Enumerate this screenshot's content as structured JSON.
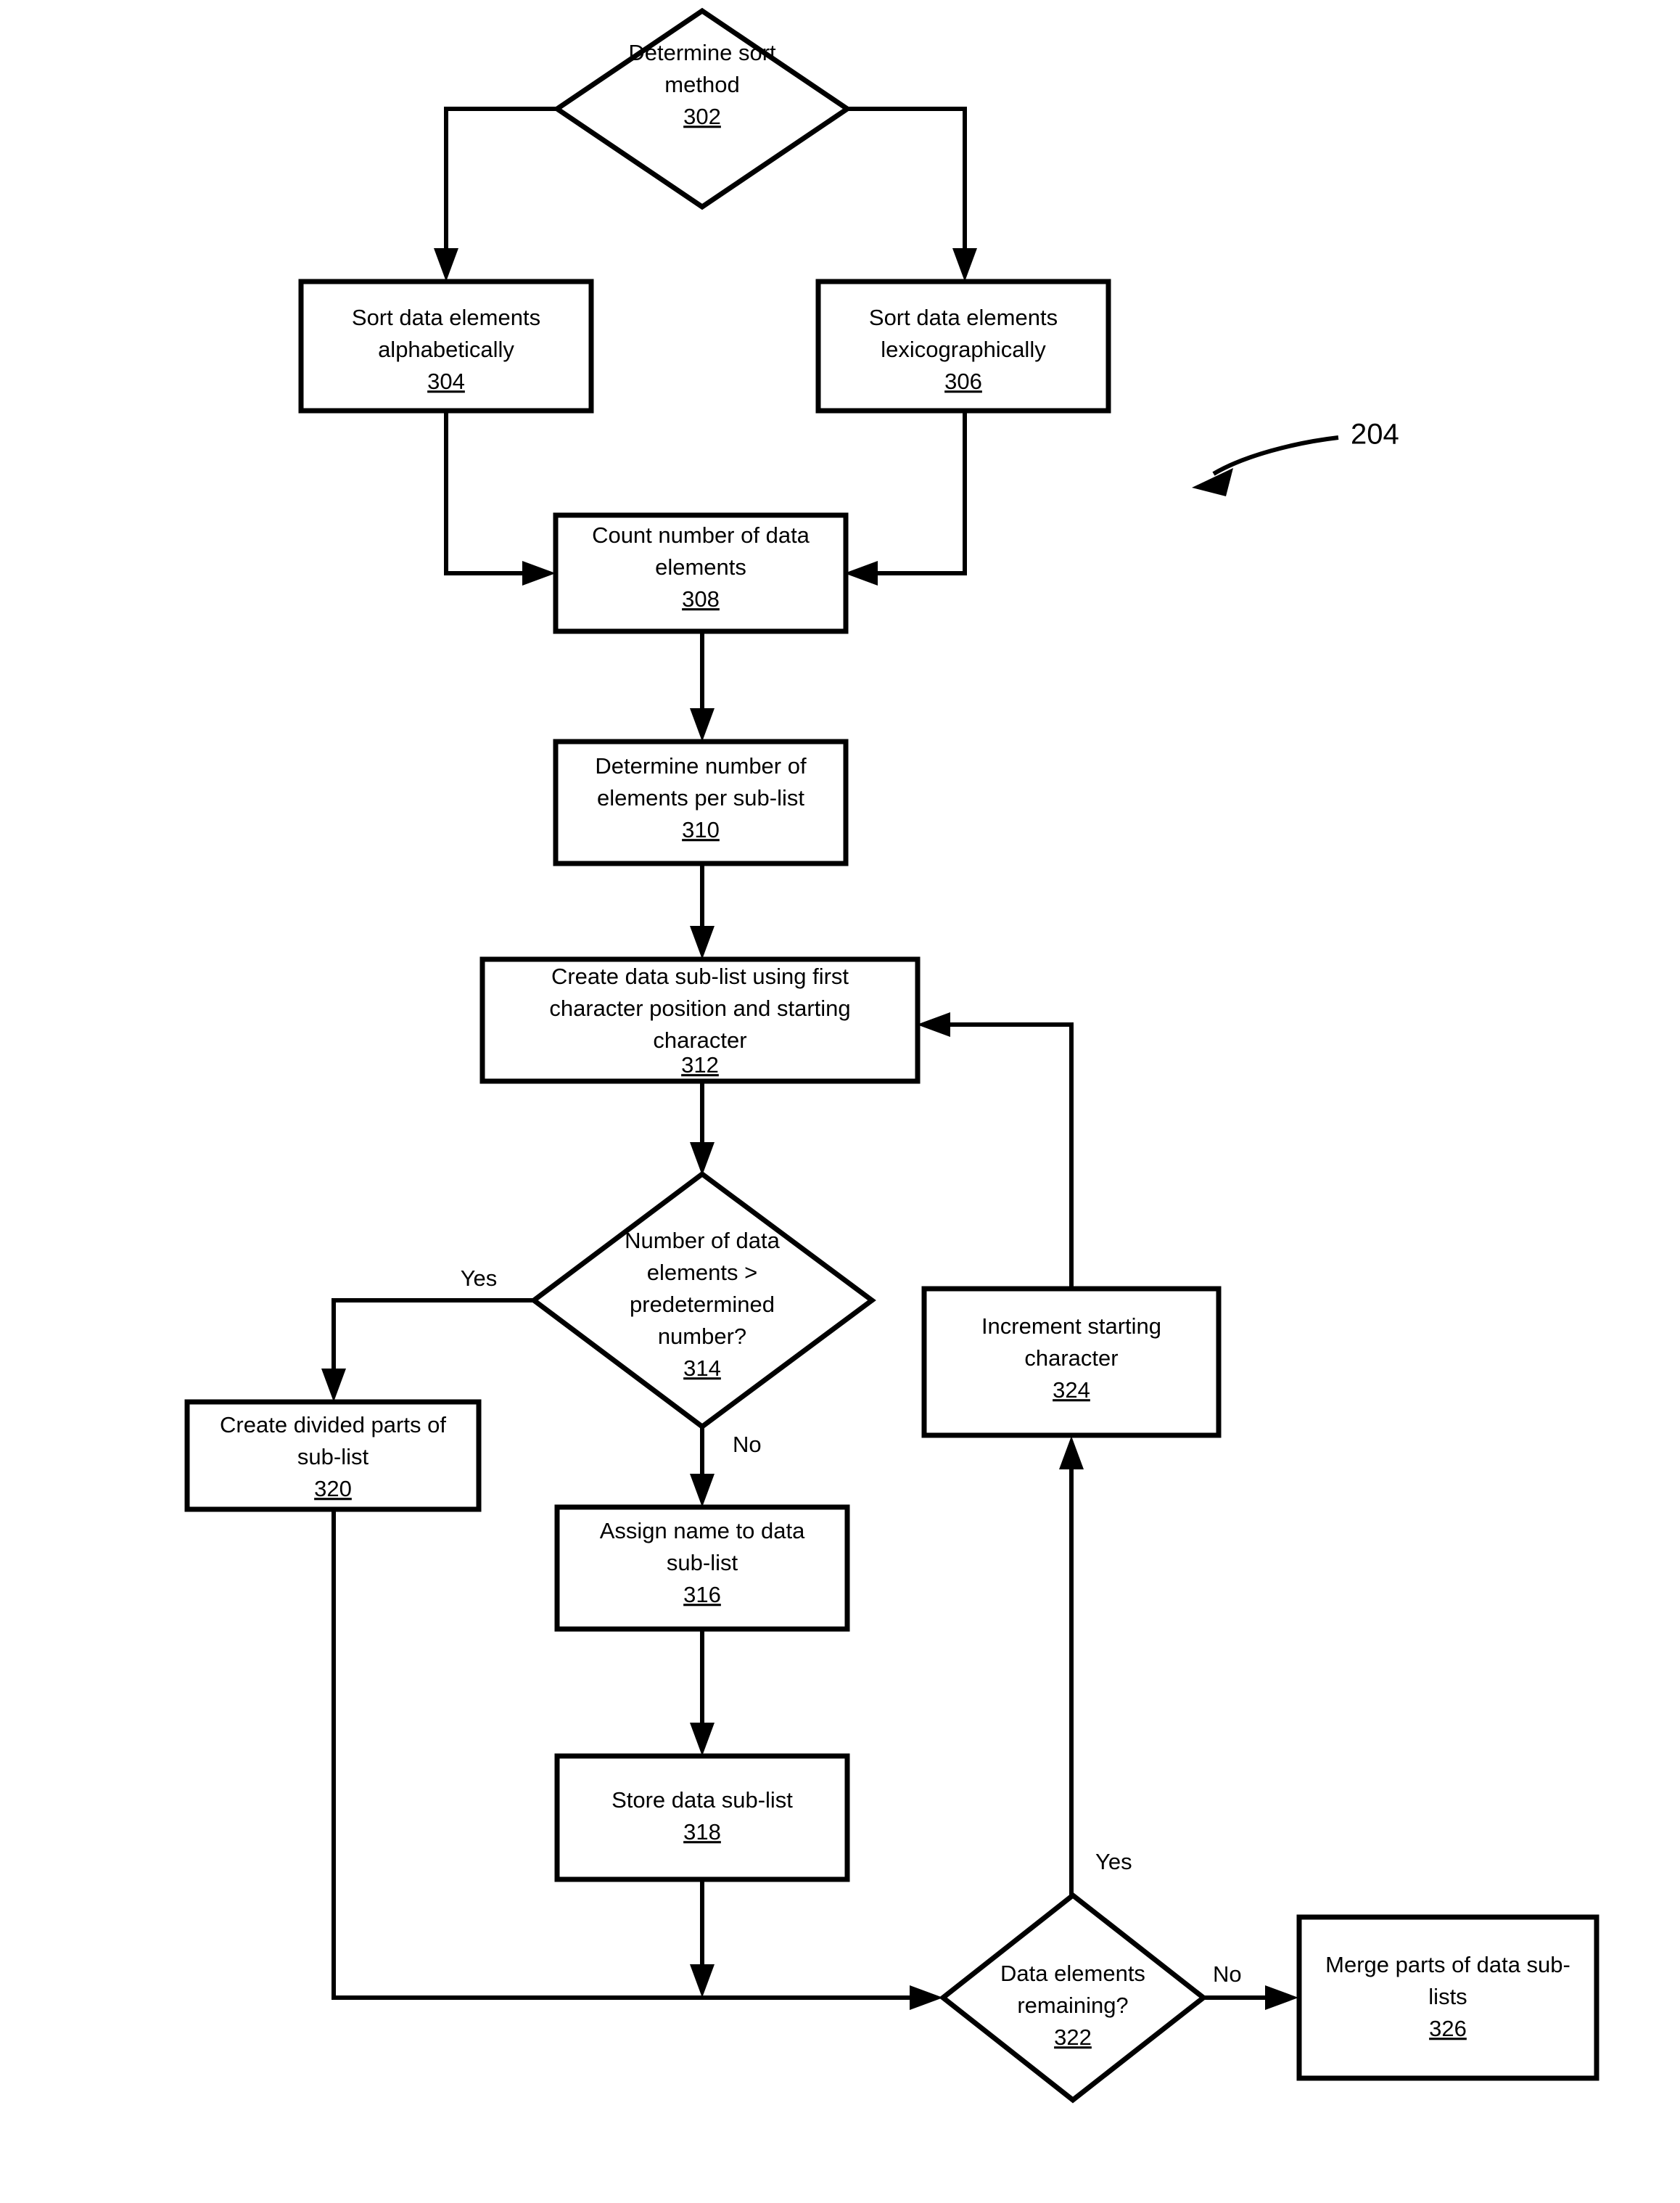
{
  "figure": {
    "reference_numeral": "204",
    "type": "flowchart"
  },
  "nodes": [
    {
      "id": "n302",
      "shape": "diamond",
      "ref": "302",
      "lines": [
        "Determine sort",
        "method"
      ]
    },
    {
      "id": "n304",
      "shape": "rectangle",
      "ref": "304",
      "lines": [
        "Sort data elements",
        "alphabetically"
      ]
    },
    {
      "id": "n306",
      "shape": "rectangle",
      "ref": "306",
      "lines": [
        "Sort data elements",
        "lexicographically"
      ]
    },
    {
      "id": "n308",
      "shape": "rectangle",
      "ref": "308",
      "lines": [
        "Count number of data",
        "elements"
      ]
    },
    {
      "id": "n310",
      "shape": "rectangle",
      "ref": "310",
      "lines": [
        "Determine number of",
        "elements per sub-list"
      ]
    },
    {
      "id": "n312",
      "shape": "rectangle",
      "ref": "312",
      "lines": [
        "Create data sub-list using first",
        "character position and starting",
        "character"
      ]
    },
    {
      "id": "n314",
      "shape": "diamond",
      "ref": "314",
      "lines": [
        "Number of data",
        "elements >",
        "predetermined",
        "number?"
      ]
    },
    {
      "id": "n316",
      "shape": "rectangle",
      "ref": "316",
      "lines": [
        "Assign name to data",
        "sub-list"
      ]
    },
    {
      "id": "n318",
      "shape": "rectangle",
      "ref": "318",
      "lines": [
        "Store data sub-list"
      ]
    },
    {
      "id": "n320",
      "shape": "rectangle",
      "ref": "320",
      "lines": [
        "Create divided parts of",
        "sub-list"
      ]
    },
    {
      "id": "n322",
      "shape": "diamond",
      "ref": "322",
      "lines": [
        "Data elements",
        "remaining?"
      ]
    },
    {
      "id": "n324",
      "shape": "rectangle",
      "ref": "324",
      "lines": [
        "Increment starting",
        "character"
      ]
    },
    {
      "id": "n326",
      "shape": "rectangle",
      "ref": "326",
      "lines": [
        "Merge parts of data sub-",
        "lists"
      ]
    }
  ],
  "edge_labels": {
    "yes_314": "Yes",
    "no_314": "No",
    "yes_322": "Yes",
    "no_322": "No"
  },
  "text": {
    "n302_l0": "Determine sort",
    "n302_l1": "method",
    "n302_ref": "302",
    "n304_l0": "Sort data elements",
    "n304_l1": "alphabetically",
    "n304_ref": "304",
    "n306_l0": "Sort data elements",
    "n306_l1": "lexicographically",
    "n306_ref": "306",
    "n308_l0": "Count number of data",
    "n308_l1": "elements",
    "n308_ref": "308",
    "n310_l0": "Determine number of",
    "n310_l1": "elements per sub-list",
    "n310_ref": "310",
    "n312_l0": "Create data sub-list using first",
    "n312_l1": "character position and starting",
    "n312_l2": "character",
    "n312_ref": "312",
    "n314_l0": "Number of data",
    "n314_l1": "elements >",
    "n314_l2": "predetermined",
    "n314_l3": "number?",
    "n314_ref": "314",
    "n316_l0": "Assign name to data",
    "n316_l1": "sub-list",
    "n316_ref": "316",
    "n318_l0": "Store data sub-list",
    "n318_ref": "318",
    "n320_l0": "Create divided parts of",
    "n320_l1": "sub-list",
    "n320_ref": "320",
    "n322_l0": "Data elements",
    "n322_l1": "remaining?",
    "n322_ref": "322",
    "n324_l0": "Increment starting",
    "n324_l1": "character",
    "n324_ref": "324",
    "n326_l0": "Merge parts of data sub-",
    "n326_l1": "lists",
    "n326_ref": "326",
    "label_yes_314": "Yes",
    "label_no_314": "No",
    "label_yes_322": "Yes",
    "label_no_322": "No",
    "figure_ref": "204"
  },
  "colors": {
    "stroke": "#000000",
    "fill": "#ffffff",
    "background": "#ffffff"
  }
}
